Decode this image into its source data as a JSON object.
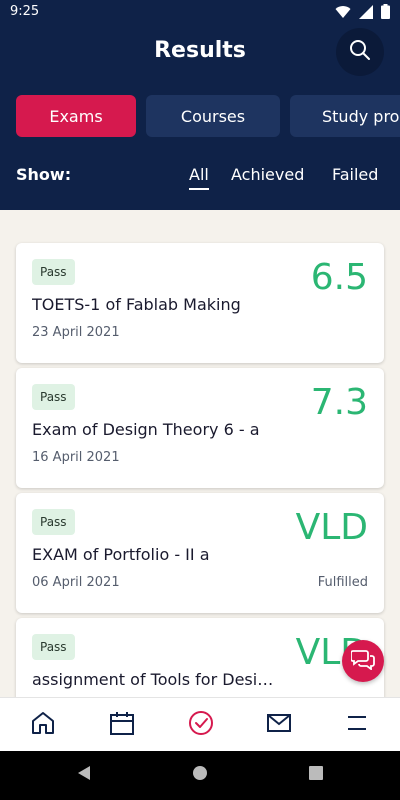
{
  "status_bar": {
    "time": "9:25"
  },
  "header": {
    "title": "Results"
  },
  "tabs": [
    {
      "label": "Exams",
      "active": true
    },
    {
      "label": "Courses",
      "active": false
    },
    {
      "label": "Study pro",
      "active": false
    }
  ],
  "filters": {
    "show_label": "Show:",
    "options": [
      "All",
      "Achieved",
      "Failed"
    ],
    "selected": "All"
  },
  "results": [
    {
      "badge": "Pass",
      "grade": "6.5",
      "title": "TOETS-1 of Fablab Making",
      "date": "23 April 2021",
      "status": ""
    },
    {
      "badge": "Pass",
      "grade": "7.3",
      "title": "Exam of Design Theory 6 - a",
      "date": "16 April 2021",
      "status": ""
    },
    {
      "badge": "Pass",
      "grade": "VLD",
      "title": "EXAM of Portfolio - II a",
      "date": "06 April 2021",
      "status": "Fulfilled"
    },
    {
      "badge": "Pass",
      "grade": "VLD",
      "title": "assignment of Tools for Desi…",
      "date": "",
      "status": ""
    }
  ],
  "bottom_nav": {
    "items": [
      "home-icon",
      "calendar-icon",
      "results-check-icon",
      "mail-icon",
      "menu-icon"
    ],
    "active": "results-check-icon"
  },
  "colors": {
    "header_bg": "#0f2248",
    "accent": "#d6194e",
    "grade_green": "#2bb673",
    "badge_bg": "#dff2e4",
    "inactive_tab": "#1e3460",
    "nav_icon": "#0f2248"
  }
}
